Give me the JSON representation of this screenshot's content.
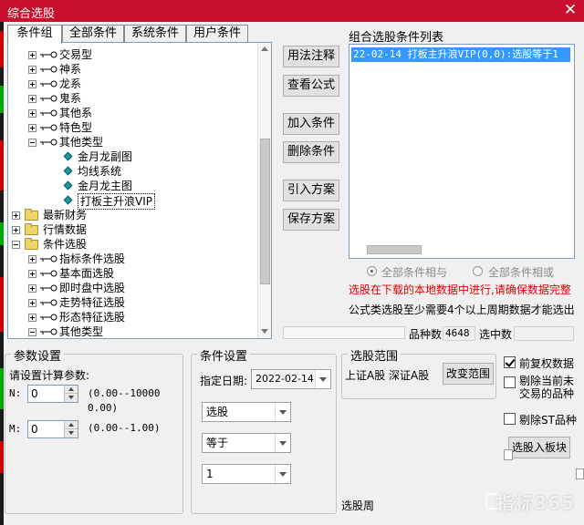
{
  "window": {
    "title": "综合选股",
    "close_glyph": "✕"
  },
  "tabs": [
    "条件组",
    "全部条件",
    "系统条件",
    "用户条件"
  ],
  "tree": {
    "items": [
      {
        "label": "交易型",
        "icon": "key-icon",
        "expander": "plus"
      },
      {
        "label": "神系",
        "icon": "key-icon",
        "expander": "plus"
      },
      {
        "label": "龙系",
        "icon": "key-icon",
        "expander": "plus"
      },
      {
        "label": "鬼系",
        "icon": "key-icon",
        "expander": "plus"
      },
      {
        "label": "其他系",
        "icon": "key-icon",
        "expander": "plus"
      },
      {
        "label": "特色型",
        "icon": "key-icon",
        "expander": "plus"
      },
      {
        "label": "其他类型",
        "icon": "key-icon",
        "expander": "minus"
      },
      {
        "label": "金月龙副图",
        "icon": "formula-icon"
      },
      {
        "label": "均线系统",
        "icon": "formula-icon"
      },
      {
        "label": "金月龙主图",
        "icon": "formula-icon"
      },
      {
        "label": "打板主升浪VIP",
        "icon": "formula-icon",
        "selected": true
      },
      {
        "label": "最新财务",
        "icon": "folder-icon",
        "expander": "plus"
      },
      {
        "label": "行情数据",
        "icon": "folder-icon",
        "expander": "plus"
      },
      {
        "label": "条件选股",
        "icon": "folder-icon",
        "expander": "minus"
      },
      {
        "label": "指标条件选股",
        "icon": "key-icon",
        "expander": "plus"
      },
      {
        "label": "基本面选股",
        "icon": "key-icon",
        "expander": "plus"
      },
      {
        "label": "即时盘中选股",
        "icon": "key-icon",
        "expander": "plus"
      },
      {
        "label": "走势特征选股",
        "icon": "key-icon",
        "expander": "plus"
      },
      {
        "label": "形态特征选股",
        "icon": "key-icon",
        "expander": "plus"
      },
      {
        "label": "其他类型",
        "icon": "key-icon",
        "expander": "minus"
      }
    ]
  },
  "buttons": {
    "usage_notes": "用法注释",
    "view_formula": "查看公式",
    "add_condition": "加入条件",
    "delete_condition": "删除条件",
    "import_plan": "引入方案",
    "save_plan": "保存方案",
    "change_range": "改变范围",
    "select_to_block": "选股入板块"
  },
  "condition_list": {
    "label": "组合选股条件列表",
    "rows": [
      "22-02-14 打板主升浪VIP(0,0):选股等于1"
    ]
  },
  "logic": {
    "and_label": "全部条件相与",
    "or_label": "全部条件相或"
  },
  "warning_text": "选股在下载的本地数据中进行,请确保数据完整",
  "info_text": "公式类选股至少需要4个以上周期数据才能选出",
  "counts": {
    "stock_count_label": "品种数",
    "stock_count": "4648",
    "selected_label": "选中数",
    "selected_value": ""
  },
  "params": {
    "group_title": "参数设置",
    "prompt": "请设置计算参数:",
    "n_label": "N:",
    "n_value": "0",
    "n_range": "(0.00--100000.00)",
    "m_label": "M:",
    "m_value": "0",
    "m_range": "(0.00--1.00)"
  },
  "conditions": {
    "group_title": "条件设置",
    "date_label": "指定日期:",
    "date_value": "2022-02-14",
    "select_value": "选股",
    "operator_value": "等于",
    "target_value": "1"
  },
  "range": {
    "group_title": "选股范围",
    "value": "上证A股 深证A股",
    "bottom_text": "选股周"
  },
  "options": {
    "pre_adjust": {
      "label": "前复权数据",
      "checked": true
    },
    "exclude_non_trading": {
      "label": "剔除当前未交易的品种",
      "checked": false
    },
    "exclude_st": {
      "label": "剔除ST品种",
      "checked": false
    }
  },
  "watermark": "指标365"
}
